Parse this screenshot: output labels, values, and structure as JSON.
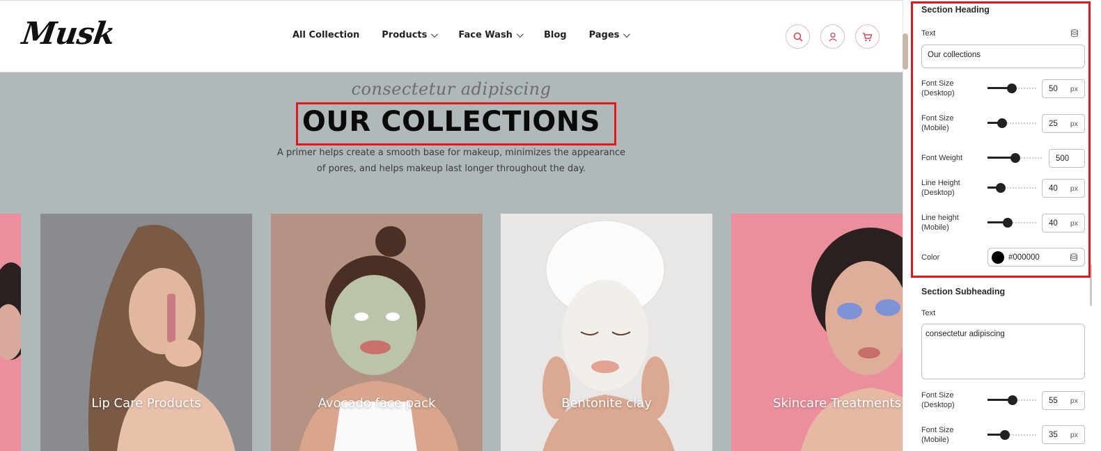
{
  "site": {
    "logo": "Musk",
    "nav": [
      {
        "label": "All Collection",
        "dropdown": false
      },
      {
        "label": "Products",
        "dropdown": true
      },
      {
        "label": "Face Wash",
        "dropdown": true
      },
      {
        "label": "Blog",
        "dropdown": false
      },
      {
        "label": "Pages",
        "dropdown": true
      }
    ],
    "icons": [
      "search-icon",
      "user-icon",
      "cart-icon"
    ],
    "accent_color": "#d9454f",
    "hero": {
      "subheading": "consectetur adipiscing",
      "heading": "OUR COLLECTIONS",
      "description": "A primer helps create a smooth base for makeup, minimizes the appearance of pores, and helps makeup last longer throughout the day."
    },
    "cards": [
      {
        "title": "Lip Care Products",
        "bg": "#8a8b8e"
      },
      {
        "title": "Avocado face pack",
        "bg": "#b49284"
      },
      {
        "title": "Bentonite clay",
        "bg": "#e9e7e5"
      },
      {
        "title": "Skincare Treatments",
        "bg": "#ec8f9c"
      }
    ]
  },
  "panel": {
    "heading_section": {
      "title": "Section Heading",
      "text_label": "Text",
      "text_value": "Our collections",
      "controls": [
        {
          "label": "Font Size\n(Desktop)",
          "value": "50",
          "unit": "px",
          "level": 0.5
        },
        {
          "label": "Font Size\n(Mobile)",
          "value": "25",
          "unit": "px",
          "level": 0.3
        },
        {
          "label": "Font Weight",
          "value": "500",
          "unit": "",
          "level": 0.5
        },
        {
          "label": "Line Height\n(Desktop)",
          "value": "40",
          "unit": "px",
          "level": 0.27
        },
        {
          "label": "Line height\n(Mobile)",
          "value": "40",
          "unit": "px",
          "level": 0.42
        }
      ],
      "color_label": "Color",
      "color_value": "#000000"
    },
    "subheading_section": {
      "title": "Section Subheading",
      "text_label": "Text",
      "text_value": "consectetur adipiscing",
      "controls": [
        {
          "label": "Font Size\n(Desktop)",
          "value": "55",
          "unit": "px",
          "level": 0.52
        },
        {
          "label": "Font Size\n(Mobile)",
          "value": "35",
          "unit": "px",
          "level": 0.35
        }
      ]
    }
  }
}
